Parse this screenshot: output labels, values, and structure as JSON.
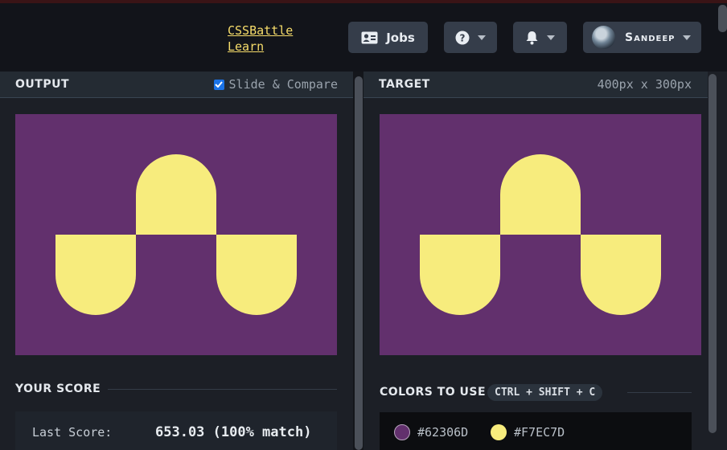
{
  "header": {
    "learn_link": "CSSBattle Learn",
    "jobs_label": "Jobs",
    "user_name": "Sandeep",
    "icons": {
      "jobs": "id-card-icon",
      "help": "question-circle-icon",
      "bell": "bell-icon",
      "caret": "caret-down-icon"
    }
  },
  "output_panel": {
    "title": "OUTPUT",
    "slide_compare_label": "Slide & Compare",
    "slide_compare_checked": true
  },
  "target_panel": {
    "title": "TARGET",
    "dimensions": "400px x 300px"
  },
  "score": {
    "title": "YOUR SCORE",
    "last_score_label": "Last Score:",
    "last_score_value": "653.03 (100% match)"
  },
  "colors": {
    "title": "COLORS TO USE",
    "shortcut": "CTRL + SHIFT + C",
    "swatches": [
      {
        "hex": "#62306D",
        "color": "#62306D"
      },
      {
        "hex": "#F7EC7D",
        "color": "#F7EC7D"
      }
    ]
  },
  "canvas": {
    "background": "#62306D",
    "shape_color": "#F7EC7D"
  }
}
